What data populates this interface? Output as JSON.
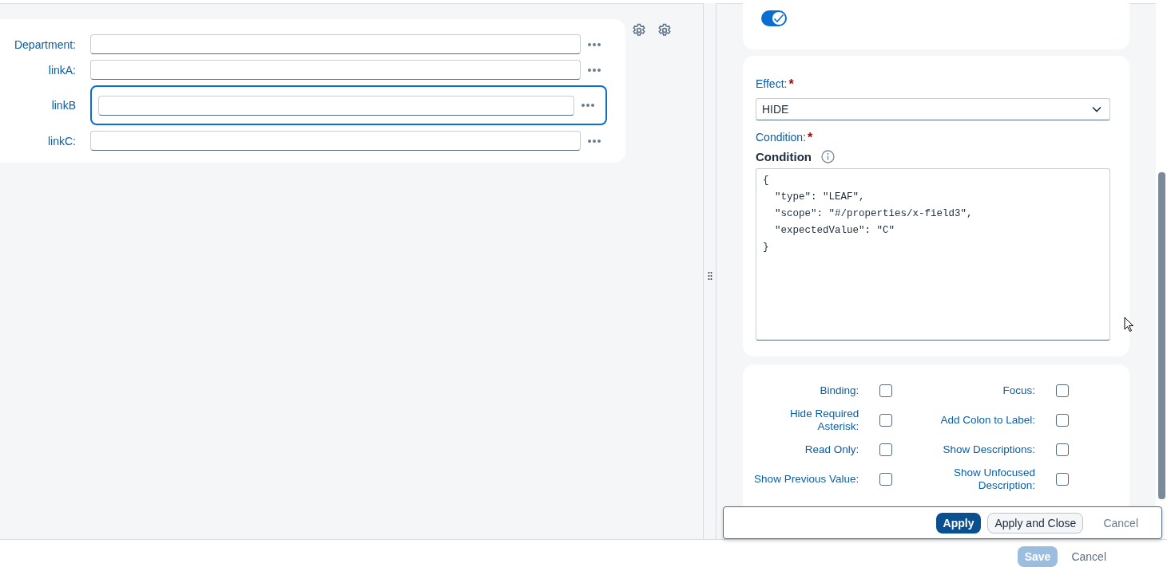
{
  "form": {
    "fields": [
      {
        "label": "Department:",
        "focused": false
      },
      {
        "label": "linkA:",
        "focused": false
      },
      {
        "label": "linkB",
        "focused": true
      },
      {
        "label": "linkC:",
        "focused": false
      }
    ]
  },
  "toggle": {
    "on": true
  },
  "effect": {
    "label": "Effect:",
    "required_mark": "*",
    "value": "HIDE"
  },
  "condition": {
    "label": "Condition:",
    "required_mark": "*",
    "title": "Condition",
    "code_lines": [
      "{",
      "  \"type\": \"LEAF\",",
      "  \"scope\": \"#/properties/x-field3\",",
      "  \"expectedValue\": \"C\"",
      "}"
    ]
  },
  "options": [
    {
      "label": "Binding:",
      "checked": false
    },
    {
      "label": "Focus:",
      "checked": false
    },
    {
      "label": "Hide Required Asterisk:",
      "checked": false
    },
    {
      "label": "Add Colon to Label:",
      "checked": false
    },
    {
      "label": "Read Only:",
      "checked": false
    },
    {
      "label": "Show Descriptions:",
      "checked": false
    },
    {
      "label": "Show Previous Value:",
      "checked": false
    },
    {
      "label": "Show Unfocused Description:",
      "checked": false
    }
  ],
  "action_bar": {
    "buttons": [
      {
        "label": "Apply",
        "kind": "primary"
      },
      {
        "label": "Apply and Close",
        "kind": "secondary"
      },
      {
        "label": "Cancel",
        "kind": "transparent"
      }
    ]
  },
  "footer": {
    "buttons": [
      {
        "label": "Save",
        "kind": "primary",
        "disabled": true
      },
      {
        "label": "Cancel",
        "kind": "transparent"
      }
    ]
  }
}
